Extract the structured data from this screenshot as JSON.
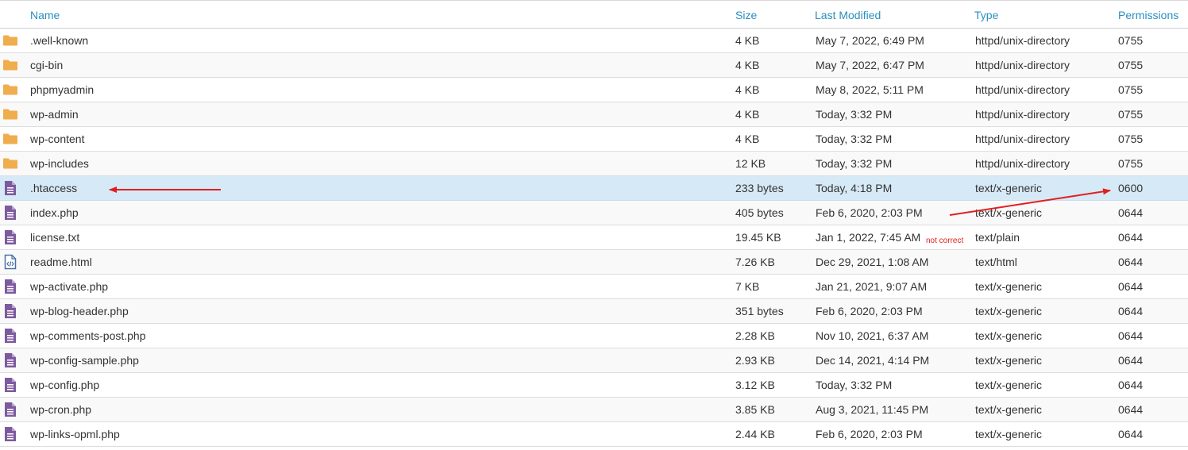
{
  "columns": {
    "name": "Name",
    "size": "Size",
    "modified": "Last Modified",
    "type": "Type",
    "permissions": "Permissions"
  },
  "rows": [
    {
      "icon": "folder-icon",
      "name": ".well-known",
      "size": "4 KB",
      "modified": "May 7, 2022, 6:49 PM",
      "type": "httpd/unix-directory",
      "permissions": "0755"
    },
    {
      "icon": "folder-icon",
      "name": "cgi-bin",
      "size": "4 KB",
      "modified": "May 7, 2022, 6:47 PM",
      "type": "httpd/unix-directory",
      "permissions": "0755"
    },
    {
      "icon": "folder-icon",
      "name": "phpmyadmin",
      "size": "4 KB",
      "modified": "May 8, 2022, 5:11 PM",
      "type": "httpd/unix-directory",
      "permissions": "0755"
    },
    {
      "icon": "folder-icon",
      "name": "wp-admin",
      "size": "4 KB",
      "modified": "Today, 3:32 PM",
      "type": "httpd/unix-directory",
      "permissions": "0755"
    },
    {
      "icon": "folder-icon",
      "name": "wp-content",
      "size": "4 KB",
      "modified": "Today, 3:32 PM",
      "type": "httpd/unix-directory",
      "permissions": "0755"
    },
    {
      "icon": "folder-icon",
      "name": "wp-includes",
      "size": "12 KB",
      "modified": "Today, 3:32 PM",
      "type": "httpd/unix-directory",
      "permissions": "0755"
    },
    {
      "icon": "text-file-icon",
      "name": ".htaccess",
      "size": "233 bytes",
      "modified": "Today, 4:18 PM",
      "type": "text/x-generic",
      "permissions": "0600",
      "selected": true
    },
    {
      "icon": "text-file-icon",
      "name": "index.php",
      "size": "405 bytes",
      "modified": "Feb 6, 2020, 2:03 PM",
      "type": "text/x-generic",
      "permissions": "0644"
    },
    {
      "icon": "text-file-icon",
      "name": "license.txt",
      "size": "19.45 KB",
      "modified": "Jan 1, 2022, 7:45 AM",
      "type": "text/plain",
      "permissions": "0644"
    },
    {
      "icon": "html-file-icon",
      "name": "readme.html",
      "size": "7.26 KB",
      "modified": "Dec 29, 2021, 1:08 AM",
      "type": "text/html",
      "permissions": "0644"
    },
    {
      "icon": "text-file-icon",
      "name": "wp-activate.php",
      "size": "7 KB",
      "modified": "Jan 21, 2021, 9:07 AM",
      "type": "text/x-generic",
      "permissions": "0644"
    },
    {
      "icon": "text-file-icon",
      "name": "wp-blog-header.php",
      "size": "351 bytes",
      "modified": "Feb 6, 2020, 2:03 PM",
      "type": "text/x-generic",
      "permissions": "0644"
    },
    {
      "icon": "text-file-icon",
      "name": "wp-comments-post.php",
      "size": "2.28 KB",
      "modified": "Nov 10, 2021, 6:37 AM",
      "type": "text/x-generic",
      "permissions": "0644"
    },
    {
      "icon": "text-file-icon",
      "name": "wp-config-sample.php",
      "size": "2.93 KB",
      "modified": "Dec 14, 2021, 4:14 PM",
      "type": "text/x-generic",
      "permissions": "0644"
    },
    {
      "icon": "text-file-icon",
      "name": "wp-config.php",
      "size": "3.12 KB",
      "modified": "Today, 3:32 PM",
      "type": "text/x-generic",
      "permissions": "0644"
    },
    {
      "icon": "text-file-icon",
      "name": "wp-cron.php",
      "size": "3.85 KB",
      "modified": "Aug 3, 2021, 11:45 PM",
      "type": "text/x-generic",
      "permissions": "0644"
    },
    {
      "icon": "text-file-icon",
      "name": "wp-links-opml.php",
      "size": "2.44 KB",
      "modified": "Feb 6, 2020, 2:03 PM",
      "type": "text/x-generic",
      "permissions": "0644"
    }
  ],
  "annotation": {
    "note": "not correct",
    "color": "#e02020"
  },
  "colors": {
    "header_text": "#2a8fbd",
    "folder": "#f0ad4e",
    "file": "#7d5a9e",
    "selected_row": "#d6e9f6"
  }
}
